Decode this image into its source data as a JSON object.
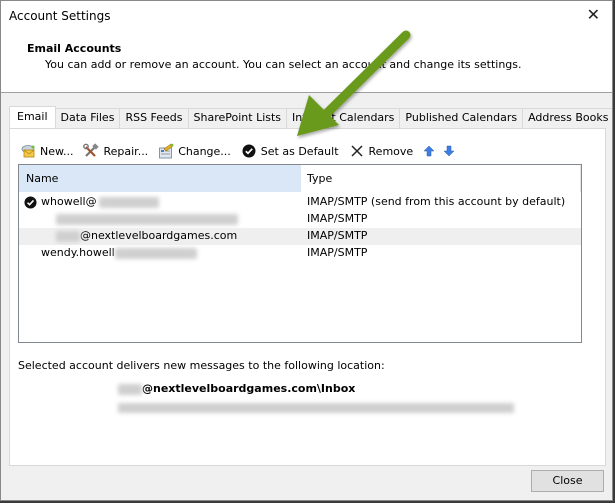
{
  "window": {
    "title": "Account Settings",
    "close_icon": "close-icon"
  },
  "header": {
    "title": "Email Accounts",
    "description": "You can add or remove an account. You can select an account and change its settings."
  },
  "tabs": [
    {
      "label": "Email",
      "active": true
    },
    {
      "label": "Data Files",
      "active": false
    },
    {
      "label": "RSS Feeds",
      "active": false
    },
    {
      "label": "SharePoint Lists",
      "active": false
    },
    {
      "label": "Internet Calendars",
      "active": false
    },
    {
      "label": "Published Calendars",
      "active": false
    },
    {
      "label": "Address Books",
      "active": false
    }
  ],
  "toolbar": {
    "new_label": "New...",
    "repair_label": "Repair...",
    "change_label": "Change...",
    "set_default_label": "Set as Default",
    "remove_label": "Remove",
    "move_up_icon": "arrow-up-icon",
    "move_down_icon": "arrow-down-icon"
  },
  "accounts_list": {
    "columns": {
      "name": "Name",
      "type": "Type"
    },
    "rows": [
      {
        "name": "whowell@",
        "type": "IMAP/SMTP (send from this account by default)",
        "default": true
      },
      {
        "name": "",
        "type": "IMAP/SMTP",
        "default": false
      },
      {
        "name": "@nextlevelboardgames.com",
        "type": "IMAP/SMTP",
        "default": false
      },
      {
        "name": "wendy.howell",
        "type": "IMAP/SMTP",
        "default": false
      }
    ]
  },
  "delivery": {
    "label": "Selected account delivers new messages to the following location:",
    "path": "@nextlevelboardgames.com\\Inbox"
  },
  "footer": {
    "close_label": "Close"
  },
  "annotation": {
    "arrow_color": "#6b9a1f"
  }
}
